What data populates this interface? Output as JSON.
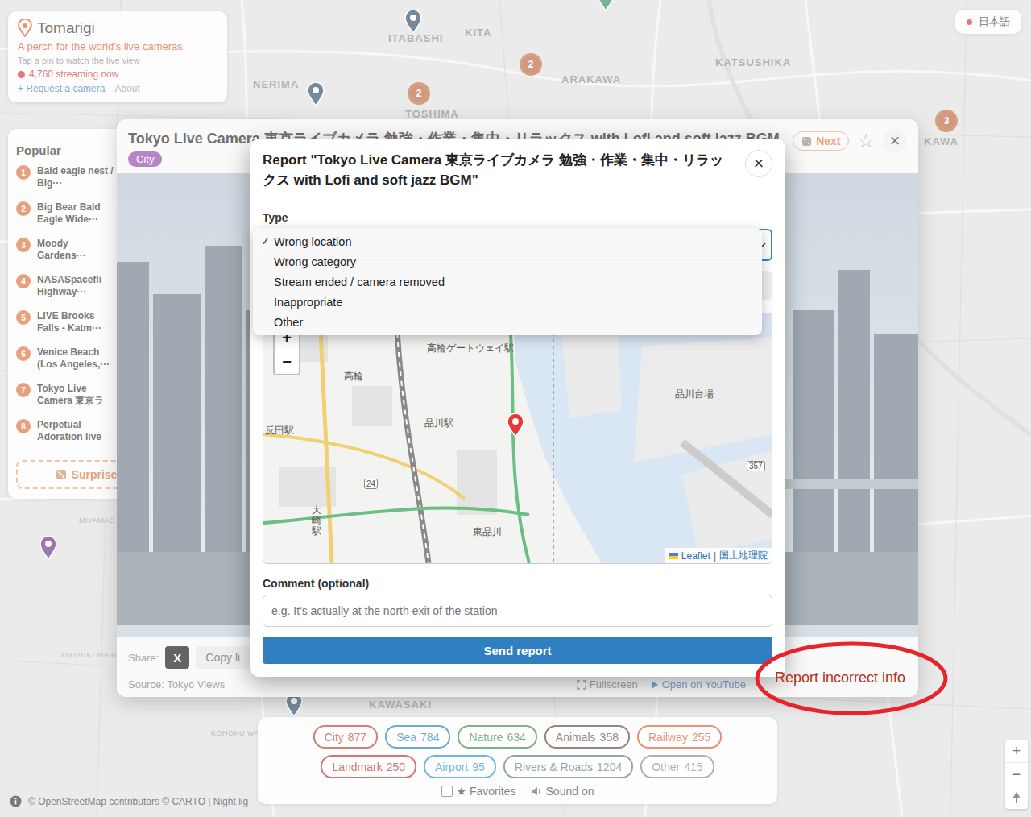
{
  "map": {
    "labels": [
      {
        "text": "ITABASHI"
      },
      {
        "text": "KITA"
      },
      {
        "text": "NERIMA"
      },
      {
        "text": "ARAKAWA"
      },
      {
        "text": "KATSUSHIKA"
      },
      {
        "text": "TOSHIMA"
      },
      {
        "text": "KAWA"
      },
      {
        "text": "MIYAMAE WARD"
      },
      {
        "text": "TSUZUKI WARD"
      },
      {
        "text": "KOHOKU WARD"
      },
      {
        "text": "KAWASAKI"
      }
    ],
    "clusters": [
      {
        "count": "2"
      },
      {
        "count": "2"
      },
      {
        "count": "3"
      }
    ],
    "pins": [
      {
        "color": "#2d4a66"
      },
      {
        "color": "#2d4a66"
      },
      {
        "color": "#2e8b57"
      },
      {
        "color": "#6a2c82"
      },
      {
        "color": "#2d4a66"
      }
    ],
    "zoom": [
      "+",
      "−"
    ],
    "attribution": "© OpenStreetMap contributors © CARTO | Night lig"
  },
  "header": {
    "logo": "Tomarigi",
    "tagline": "A perch for the world's live cameras.",
    "hint": "Tap a pin to watch the live view",
    "streaming": "4,760 streaming now",
    "request": "+ Request a camera",
    "about": "About"
  },
  "language": "日本語",
  "popular": {
    "title": "Popular",
    "items": [
      {
        "rank": "1",
        "name": "Bald eagle nest / Big···"
      },
      {
        "rank": "2",
        "name": "Big Bear Bald Eagle Wide···"
      },
      {
        "rank": "3",
        "name": "Moody Gardens···"
      },
      {
        "rank": "4",
        "name": "NASASpacefli Highway···"
      },
      {
        "rank": "5",
        "name": "LIVE Brooks Falls - Katm···"
      },
      {
        "rank": "6",
        "name": "Venice Beach (Los Angeles,···"
      },
      {
        "rank": "7",
        "name": "Tokyo Live Camera 東京ラ"
      },
      {
        "rank": "8",
        "name": "Perpetual Adoration live"
      }
    ],
    "surprise": "Surprise"
  },
  "camera": {
    "title": "Tokyo Live Camera 東京ライブカメラ 勉強・作業・集中・リラックス with Lofi and soft jazz BGM",
    "category": "City",
    "next": "Next",
    "favorite": "☆",
    "close": "×",
    "share_label": "Share:",
    "share_x": "X",
    "copy": "Copy li",
    "source": "Source: Tokyo Views",
    "fullscreen": "Fullscreen",
    "youtube": "Open on YouTube"
  },
  "annotation": {
    "text": "Report incorrect info"
  },
  "report": {
    "title": "Report \"Tokyo Live Camera 東京ライブカメラ 勉強・作業・集中・リラックス with Lofi and soft jazz BGM\"",
    "close": "×",
    "type_label": "Type",
    "check": "✓",
    "options": [
      {
        "label": "Wrong location",
        "selected": true
      },
      {
        "label": "Wrong category",
        "selected": false
      },
      {
        "label": "Stream ended / camera removed",
        "selected": false
      },
      {
        "label": "Inappropriate",
        "selected": false
      },
      {
        "label": "Other",
        "selected": false
      }
    ],
    "map": {
      "labels": [
        {
          "text": "高輪ゲートウェイ駅"
        },
        {
          "text": "高輪"
        },
        {
          "text": "品川駅"
        },
        {
          "text": "反田駅"
        },
        {
          "text": "品川台場"
        },
        {
          "text": "24"
        },
        {
          "text": "大崎駅"
        },
        {
          "text": "東品川"
        },
        {
          "text": "357"
        }
      ],
      "zoom": [
        "+",
        "−"
      ],
      "attribution": {
        "leaflet": "Leaflet",
        "sep": "|",
        "source": "国土地理院"
      }
    },
    "comment_label": "Comment (optional)",
    "comment_placeholder": "e.g. It's actually at the north exit of the station",
    "send": "Send report"
  },
  "filters": {
    "rows": [
      [
        {
          "label": "City",
          "count": "877",
          "color": "#c0392b"
        },
        {
          "label": "Sea",
          "count": "784",
          "color": "#1e7fc0"
        },
        {
          "label": "Nature",
          "count": "634",
          "color": "#3a8a3f"
        },
        {
          "label": "Animals",
          "count": "358",
          "color": "#5b4636"
        },
        {
          "label": "Railway",
          "count": "255",
          "color": "#e0552b"
        }
      ],
      [
        {
          "label": "Landmark",
          "count": "250",
          "color": "#c62828"
        },
        {
          "label": "Airport",
          "count": "95",
          "color": "#1f93cf"
        },
        {
          "label": "Rivers & Roads",
          "count": "1204",
          "color": "#5f7480"
        },
        {
          "label": "Other",
          "count": "415",
          "color": "#888888"
        }
      ]
    ],
    "favorites": {
      "label": "★ Favorites",
      "checked": false
    },
    "sound": {
      "label": "Sound on"
    }
  }
}
